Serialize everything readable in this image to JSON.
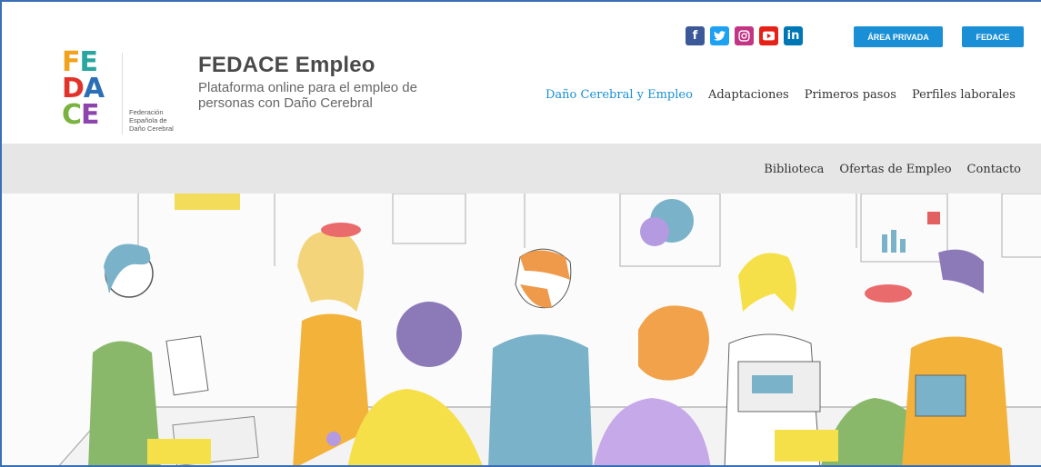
{
  "logo": {
    "letters": [
      "FE",
      "DA",
      "CE"
    ],
    "subtitle_lines": [
      "Federación",
      "Española de",
      "Daño Cerebral"
    ]
  },
  "brand": {
    "title": "FEDACE Empleo",
    "subtitle": "Plataforma online para el empleo de personas con Daño Cerebral"
  },
  "social": [
    {
      "name": "facebook",
      "glyph": "f"
    },
    {
      "name": "twitter",
      "glyph": "t"
    },
    {
      "name": "instagram",
      "glyph": "◎"
    },
    {
      "name": "youtube",
      "glyph": "▶"
    },
    {
      "name": "linkedin",
      "glyph": "in"
    }
  ],
  "header_buttons": {
    "private_area": "ÁREA PRIVADA",
    "fedace": "FEDACE"
  },
  "main_nav": [
    "Daño Cerebral y Empleo",
    "Adaptaciones",
    "Primeros pasos",
    "Perfiles laborales"
  ],
  "sub_nav": [
    "Biblioteca",
    "Ofertas de Empleo",
    "Contacto"
  ],
  "colors": {
    "accent": "#1a8fd6",
    "subnav_bg": "#e6e6e6"
  }
}
